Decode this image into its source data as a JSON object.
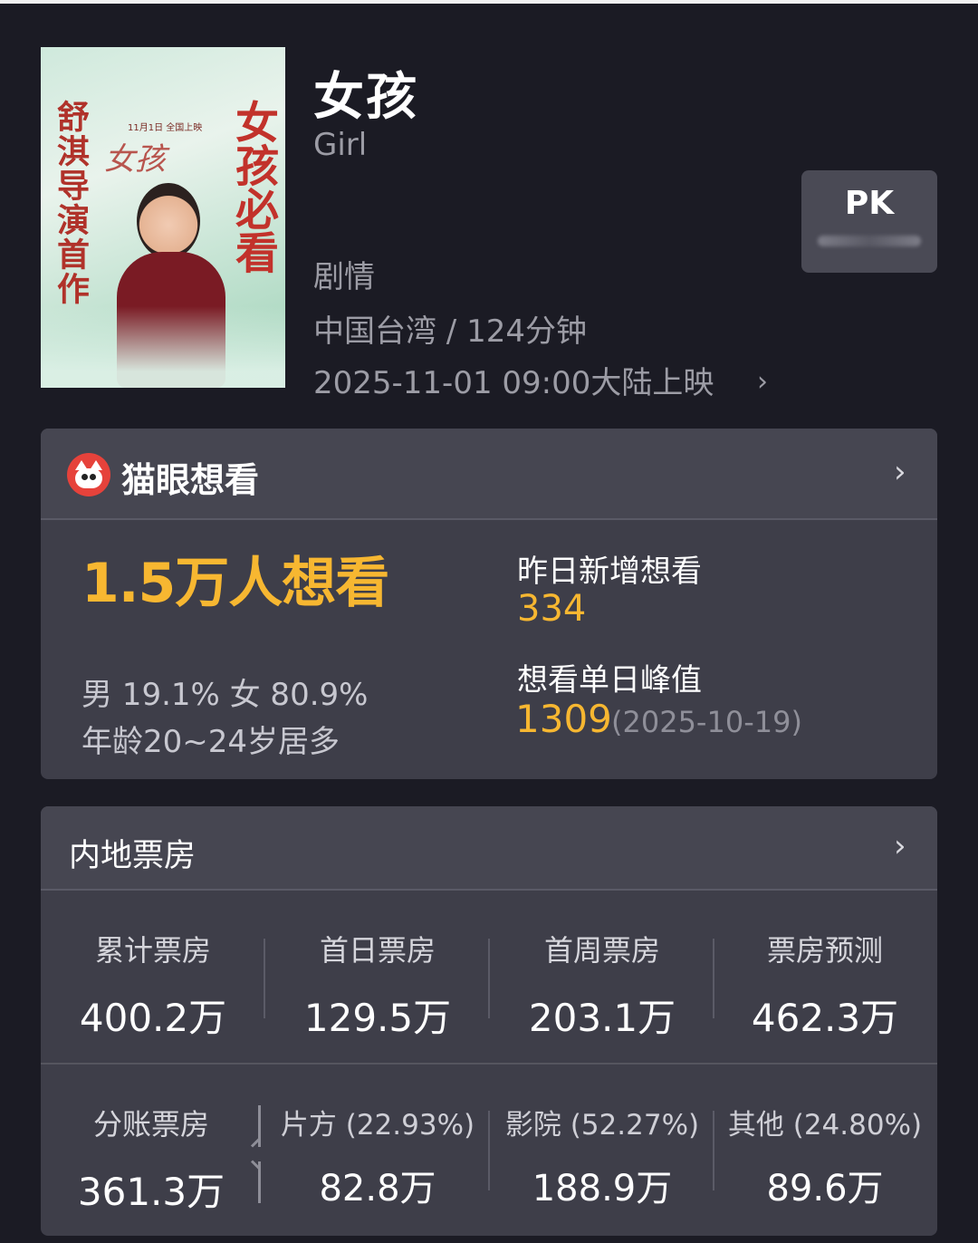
{
  "movie": {
    "title": "女孩",
    "subtitle": "Girl",
    "genre": "剧情",
    "region_runtime": "中国台湾 / 124分钟",
    "release": "2025-11-01 09:00大陆上映",
    "poster": {
      "left_text": "舒淇导演首作",
      "right_text": "女孩必看",
      "date_tag": "11月1日 全国上映",
      "script_title": "女孩"
    }
  },
  "pk_button": {
    "label": "PK"
  },
  "want_card": {
    "brand": "猫眼想看",
    "total": "1.5万人想看",
    "gender_split": "男 19.1% 女 80.9%",
    "age": "年龄20~24岁居多",
    "yesterday_label": "昨日新增想看",
    "yesterday_value": "334",
    "peak_label": "想看单日峰值",
    "peak_value": "1309",
    "peak_date": "(2025-10-19)"
  },
  "box_office_card": {
    "title": "内地票房",
    "stats": [
      {
        "label": "累计票房",
        "value": "400.2万"
      },
      {
        "label": "首日票房",
        "value": "129.5万"
      },
      {
        "label": "首周票房",
        "value": "203.1万"
      },
      {
        "label": "票房预测",
        "value": "462.3万"
      }
    ],
    "split": {
      "label": "分账票房",
      "value": "361.3万",
      "parts": [
        {
          "label": "片方 (22.93%)",
          "value": "82.8万"
        },
        {
          "label": "影院 (52.27%)",
          "value": "188.9万"
        },
        {
          "label": "其他 (24.80%)",
          "value": "89.6万"
        }
      ]
    }
  },
  "colors": {
    "background": "#1b1b24",
    "card": "#3e3e49",
    "accent": "#f7b731",
    "brand_red": "#e6423b"
  },
  "icons": [
    "cat-logo-icon",
    "chevron-right-icon"
  ]
}
